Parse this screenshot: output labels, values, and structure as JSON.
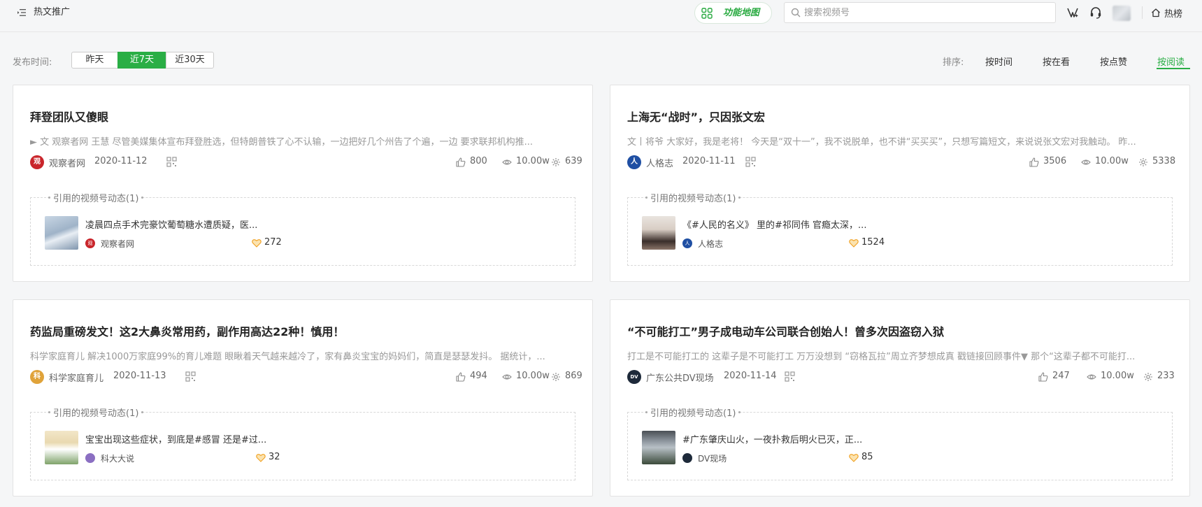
{
  "header": {
    "page_title": "热文推广",
    "function_map_label": "功能地图",
    "search_placeholder": "搜索视频号",
    "rank_label": "热榜"
  },
  "filters": {
    "date_label": "发布时间:",
    "date_options": [
      "昨天",
      "近7天",
      "近30天"
    ],
    "date_selected": "近7天",
    "sort_label": "排序:",
    "sort_options": [
      "按时间",
      "按在看",
      "按点赞",
      "按阅读"
    ],
    "sort_selected": "按阅读"
  },
  "ref_section_label": "引用的视频号动态(1)",
  "articles": [
    {
      "title": "拜登团队又傻眼",
      "excerpt": "► 文 观察者网 王慧 尽管美媒集体宣布拜登胜选，但特朗普铁了心不认输，一边把好几个州告了个遍，一边 要求联邦机构推...",
      "source": "观察者网",
      "source_logo_text": "观",
      "source_logo_color": "#c9252b",
      "date": "2020-11-12",
      "likes": "800",
      "reads": "10.00w",
      "shares": "639",
      "ref": {
        "text": "凌晨四点手术完豪饮葡萄糖水遭质疑，医...",
        "source": "观察者网",
        "likes": "272"
      }
    },
    {
      "title": "上海无“战时”，只因张文宏",
      "excerpt": "文丨将爷 大家好，我是老将！ 今天是“双十一”，我不说脱单，也不讲“买买买”，只想写篇短文，来说说张文宏对我触动。 昨...",
      "source": "人格志",
      "source_logo_text": "人",
      "source_logo_color": "#1f4fa3",
      "date": "2020-11-11",
      "likes": "3506",
      "reads": "10.00w",
      "shares": "5338",
      "ref": {
        "text": "《#人民的名义》 里的#祁同伟 官瘾太深，...",
        "source": "人格志",
        "likes": "1524"
      }
    },
    {
      "title": "药监局重磅发文！这2大鼻炎常用药，副作用高达22种！慎用！",
      "excerpt": "科学家庭育儿 解决1000万家庭99%的育儿难题 眼瞅着天气越来越冷了，家有鼻炎宝宝的妈妈们，简直是瑟瑟发抖。 据统计，...",
      "source": "科学家庭育儿",
      "source_logo_text": "科",
      "source_logo_color": "#e0a33a",
      "date": "2020-11-13",
      "likes": "494",
      "reads": "10.00w",
      "shares": "869",
      "ref": {
        "text": "宝宝出现这些症状，到底是#感冒 还是#过...",
        "source": "科大大说",
        "likes": "32"
      }
    },
    {
      "title": "“不可能打工”男子成电动车公司联合创始人！曾多次因盗窃入狱",
      "excerpt": "打工是不可能打工的 这辈子是不可能打工 万万没想到 “窃格瓦拉”周立齐梦想成真 戳链接回顾事件▼ 那个“这辈子都不可能打...",
      "source": "广东公共DV现场",
      "source_logo_text": "DV",
      "source_logo_color": "#1e2a3a",
      "date": "2020-11-14",
      "likes": "247",
      "reads": "10.00w",
      "shares": "233",
      "ref": {
        "text": "#广东肇庆山火，一夜扑救后明火已灭，正...",
        "source": "DV现场",
        "likes": "85"
      }
    }
  ],
  "colors": {
    "accent": "#2aae45",
    "like_heart": "#f0a020"
  }
}
